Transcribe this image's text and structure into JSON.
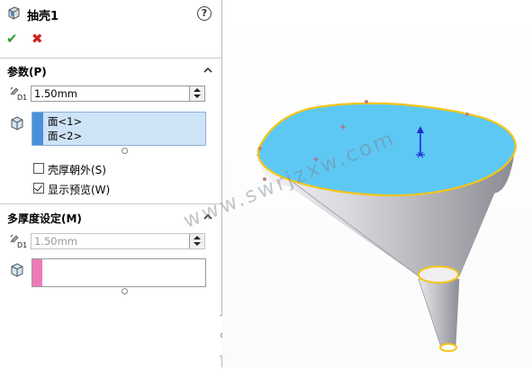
{
  "header": {
    "title": "抽壳1",
    "help": "?",
    "ok": "✔",
    "cancel": "✖"
  },
  "params": {
    "title": "参数(P)",
    "thickness": "1.50mm",
    "faces": [
      "面<1>",
      "面<2>"
    ],
    "shell_outward": {
      "label": "壳厚朝外(S)",
      "checked": false
    },
    "show_preview": {
      "label": "显示预览(W)",
      "checked": true
    }
  },
  "multi": {
    "title": "多厚度设定(M)",
    "thickness": "1.50mm"
  },
  "viewport": {
    "watermark": "www.swrjzxw.com"
  },
  "colors": {
    "face": "#5ec8f5",
    "edge": "#f5c518",
    "body": "#b5b5bb",
    "accent": "#4a90d9",
    "pink": "#f07ab8"
  }
}
